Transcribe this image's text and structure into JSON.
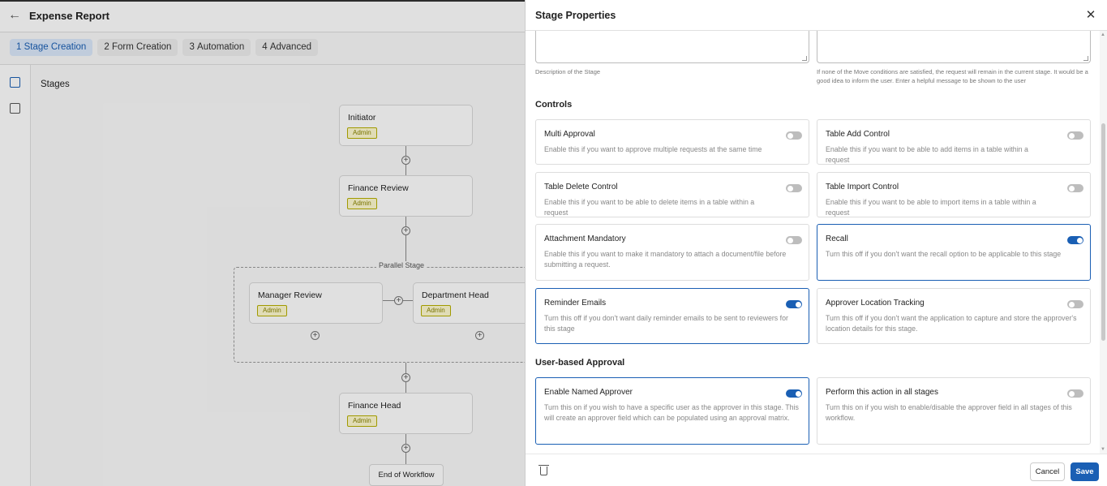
{
  "app": {
    "title": "Expense Report",
    "steps": [
      {
        "num": "1",
        "label": "Stage Creation"
      },
      {
        "num": "2",
        "label": "Form Creation"
      },
      {
        "num": "3",
        "label": "Automation"
      },
      {
        "num": "4",
        "label": "Advanced"
      }
    ],
    "stages_label": "Stages",
    "workflow": {
      "initiator": {
        "name": "Initiator",
        "badge": "Admin"
      },
      "finance_review": {
        "name": "Finance Review",
        "badge": "Admin"
      },
      "parallel_label": "Parallel Stage",
      "manager_review": {
        "name": "Manager Review",
        "badge": "Admin"
      },
      "department_head": {
        "name": "Department Head",
        "badge": "Admin"
      },
      "finance_head": {
        "name": "Finance Head",
        "badge": "Admin"
      },
      "end": "End of Workflow"
    }
  },
  "panel": {
    "title": "Stage Properties",
    "description_help": "Description of the Stage",
    "fallback_help": "If none of the Move conditions are satisfied, the request will remain in the current stage. It would be a good idea to inform the user. Enter a helpful message to be shown to the user",
    "controls_title": "Controls",
    "controls": [
      {
        "title": "Multi Approval",
        "desc": "Enable this if you want to approve multiple requests at the same time",
        "on": false
      },
      {
        "title": "Table Add Control",
        "desc": "Enable this if you want to be able to add items in a table within a request",
        "on": false
      },
      {
        "title": "Table Delete Control",
        "desc": "Enable this if you want to be able to delete items in a table within a request",
        "on": false
      },
      {
        "title": "Table Import Control",
        "desc": "Enable this if you want to be able to import items in a table within a request",
        "on": false
      },
      {
        "title": "Attachment Mandatory",
        "desc": "Enable this if you want to make it mandatory to attach a document/file before submitting a request.",
        "on": false
      },
      {
        "title": "Recall",
        "desc": "Turn this off if you don't want the recall option to be applicable to this stage",
        "on": true
      },
      {
        "title": "Reminder Emails",
        "desc": "Turn this off if you don't want daily reminder emails to be sent to reviewers for this stage",
        "on": true
      },
      {
        "title": "Approver Location Tracking",
        "desc": "Turn this off if you don't want the application to capture and store the approver's location details for this stage.",
        "on": false
      }
    ],
    "user_approval_title": "User-based Approval",
    "user_approval": [
      {
        "title": "Enable Named Approver",
        "desc": "Turn this on if you wish to have a specific user as the approver in this stage. This will create an approver field which can be populated using an approval matrix.",
        "on": true
      },
      {
        "title": "Perform this action in all stages",
        "desc": "Turn this on if you wish to enable/disable the approver field in all stages of this workflow.",
        "on": false
      }
    ],
    "footer": {
      "cancel": "Cancel",
      "save": "Save"
    }
  }
}
